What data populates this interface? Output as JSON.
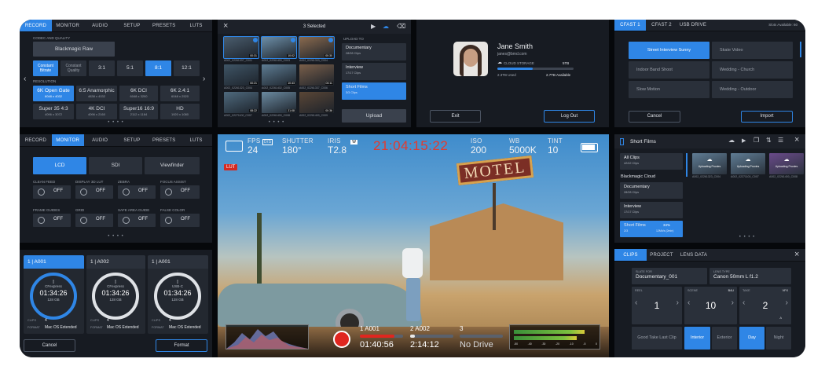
{
  "record": {
    "tabs": [
      "RECORD",
      "MONITOR",
      "AUDIO",
      "SETUP",
      "PRESETS",
      "LUTS"
    ],
    "codec_label": "CODEC AND QUALITY",
    "codec": "Blackmagic Raw",
    "bitrate_modes": [
      "Constant Bitrate",
      "Constant Quality"
    ],
    "ratios": [
      "3:1",
      "5:1",
      "8:1",
      "12:1"
    ],
    "resolution_label": "RESOLUTION",
    "resolutions": [
      {
        "name": "6K Open Gate",
        "dim": "6048 x 4032"
      },
      {
        "name": "6:5 Anamorphic",
        "dim": "4838 x 4032"
      },
      {
        "name": "6K DCI",
        "dim": "6048 x 3200"
      },
      {
        "name": "6K 2.4:1",
        "dim": "6048 x 2520"
      },
      {
        "name": "Super 35 4:3",
        "dim": "4096 x 3072"
      },
      {
        "name": "4K DCI",
        "dim": "4096 x 2160"
      },
      {
        "name": "Super16 16:9",
        "dim": "2112 x 1184"
      },
      {
        "name": "HD",
        "dim": "1920 x 1080"
      }
    ],
    "dots": "• • • •"
  },
  "monitor": {
    "tabs": [
      "RECORD",
      "MONITOR",
      "AUDIO",
      "SETUP",
      "PRESETS",
      "LUTS"
    ],
    "outputs": [
      "LCD",
      "SDI",
      "Viewfinder"
    ],
    "toggles": [
      {
        "label": "CLEAN FEED",
        "value": "OFF"
      },
      {
        "label": "DISPLAY 3D LUT",
        "value": "OFF"
      },
      {
        "label": "ZEBRA",
        "value": "OFF"
      },
      {
        "label": "FOCUS ASSIST",
        "value": "OFF"
      },
      {
        "label": "FRAME GUIDES",
        "value": "OFF"
      },
      {
        "label": "GRID",
        "value": "OFF"
      },
      {
        "label": "SAFE AREA GUIDE",
        "value": "OFF"
      },
      {
        "label": "FALSE COLOR",
        "value": "OFF"
      }
    ],
    "dots": "• • • •"
  },
  "media": {
    "cards": [
      {
        "title": "1 | A001",
        "type": "CFexpress",
        "time": "01:34:26",
        "size": "128 GB",
        "clips_label": "CLIPS",
        "clips": "4",
        "format_label": "FORMAT",
        "format": "Mac OS Extended"
      },
      {
        "title": "1 | A002",
        "type": "CFexpress",
        "time": "01:34:26",
        "size": "128 GB",
        "clips_label": "CLIPS",
        "clips": "4",
        "format_label": "FORMAT",
        "format": "Mac OS Extended"
      },
      {
        "title": "1 | A001",
        "type": "USB-C",
        "time": "01:34:26",
        "size": "128 GB",
        "clips_label": "CLIPS",
        "clips": "4",
        "format_label": "FORMAT",
        "format": "Mac OS Extended"
      }
    ],
    "cancel": "Cancel",
    "format_btn": "Format"
  },
  "upload": {
    "selected": "3 Selected",
    "upload_to": "UPLOAD TO",
    "thumbs": [
      {
        "cap": "A002_02261337_C001",
        "dur": "00:31"
      },
      {
        "cap": "A002_02261400_C003",
        "dur": "10:02"
      },
      {
        "cap": "A002_02261333_C004",
        "dur": "00:30"
      },
      {
        "cap": "A002_02261323_C004",
        "dur": "00:21"
      },
      {
        "cap": "A002_02261402_C005",
        "dur": "10:43"
      },
      {
        "cap": "A002_02261337_C006",
        "dur": "00:11"
      },
      {
        "cap": "A002_02271100_C007",
        "dur": "08:22"
      },
      {
        "cap": "A002_02261400_C008",
        "dur": "21:08"
      },
      {
        "cap": "A002_02261400_C009",
        "dur": "00:36"
      }
    ],
    "folders": [
      {
        "name": "Documentary",
        "sub": "28/28 Clips"
      },
      {
        "name": "Interview",
        "sub": "17/17 Clips"
      },
      {
        "name": "Short Films",
        "sub": "3/3 Clips"
      }
    ],
    "upload_btn": "Upload",
    "dots": "• • • •"
  },
  "profile": {
    "name": "Jane Smith",
    "email": "janes@bmd.com",
    "storage_label": "CLOUD STORAGE",
    "storage_total": "5TB",
    "used": "2.3TB Used",
    "used_fraction": 0.46,
    "available": "2.7TB Available",
    "exit": "Exit",
    "logout": "Log Out"
  },
  "presets": {
    "tabs": [
      "CFAST 1",
      "CFAST 2",
      "USB DRIVE"
    ],
    "slots": "Slots Available: 60",
    "items": [
      "Street Interview Sunny",
      "Skate Video",
      "Indoor Band Shoot",
      "Wedding - Church",
      "Slow Motion",
      "Wedding - Outdoor"
    ],
    "cancel": "Cancel",
    "import": "Import"
  },
  "hud": {
    "fps_label": "FPS",
    "fps_badge": "D/S",
    "fps": "24",
    "shutter_label": "SHUTTER",
    "shutter": "180°",
    "iris_label": "IRIS",
    "iris_badge": "W",
    "iris": "T2.8",
    "timecode": "21:04:15:22",
    "iso_label": "ISO",
    "iso": "200",
    "wb_label": "WB",
    "wb": "5000K",
    "tint_label": "TINT",
    "tint": "10",
    "lut": "LUT",
    "sign": "MOTEL",
    "card1": "1 A001",
    "card1_time": "01:40:56",
    "card1_fill": 0.8,
    "card2": "2 A002",
    "card2_time": "2:14:12",
    "card2_fill": 0.1,
    "card3": "3",
    "card3_time": "No Drive",
    "meter_ticks": [
      "-50",
      "-40",
      "-30",
      "-20",
      "-10",
      "-5",
      "0"
    ]
  },
  "cloud": {
    "title": "Short Films",
    "folders": [
      {
        "name": "All Clips",
        "sub": "42/42 Clips"
      },
      {
        "name": "Documentary",
        "sub": "28/28 Clips"
      },
      {
        "name": "Interview",
        "sub": "17/17 Clips"
      },
      {
        "name": "Short Films",
        "sub": "2/3",
        "pct": "34%",
        "rate": "12Mb/s (2min)"
      }
    ],
    "group": "Blackmagic Cloud",
    "thumbs": [
      {
        "status": "Uploading Proxies",
        "cap": "A002_02261323_C004"
      },
      {
        "status": "Uploading Proxies",
        "cap": "A002_02271100_C007"
      },
      {
        "status": "Uploading Proxies",
        "cap": "A002_02261400_C008"
      }
    ],
    "dots": "• • • •"
  },
  "meta": {
    "tabs": [
      "CLIPS",
      "PROJECT",
      "LENS DATA"
    ],
    "slate_label": "SLATE FOR",
    "slate": "Documentary_001",
    "lens_label": "LENS TYPE",
    "lens": "Canon 50mm L f1.2",
    "reel_label": "REEL",
    "reel": "1",
    "scene_label": "SCENE",
    "scene_badge": "B4U",
    "scene": "10",
    "take_label": "TAKE",
    "take_badge": "VFX",
    "take": "2",
    "take_sub": "A",
    "options": [
      "Good Take Last Clip",
      "Interior",
      "Exterior",
      "Day",
      "Night"
    ]
  }
}
